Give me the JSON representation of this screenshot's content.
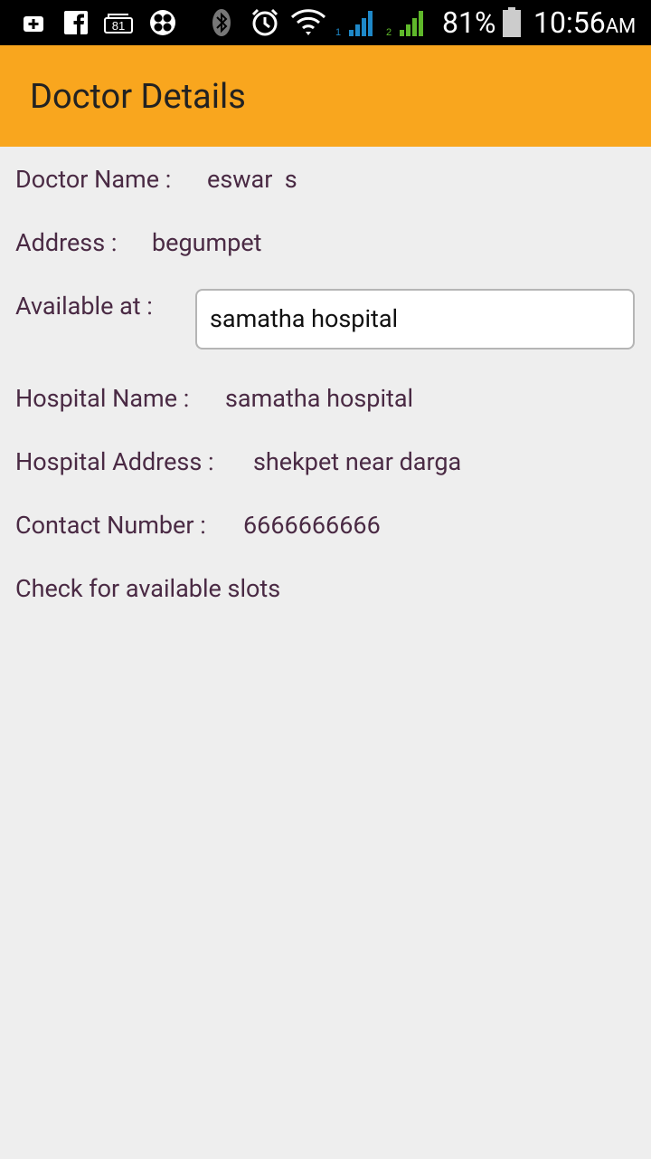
{
  "status_bar": {
    "battery_percent": "81%",
    "time": "10:56",
    "ampm": "AM",
    "sim1_label": "1",
    "sim2_label": "2",
    "notification_badge": "81",
    "icons": [
      "plus-box-icon",
      "facebook-icon",
      "notification-81-icon",
      "fan-icon",
      "bluetooth-icon",
      "alarm-icon",
      "wifi-icon",
      "signal-sim1-icon",
      "signal-sim2-icon",
      "battery-icon"
    ]
  },
  "action_bar": {
    "title": "Doctor Details"
  },
  "details": {
    "doctor_name_label": "Doctor Name :",
    "doctor_name_value": "eswar  s",
    "address_label": "Address :",
    "address_value": "begumpet",
    "available_at_label": "Available at :",
    "available_at_value": "samatha hospital",
    "hospital_name_label": "Hospital Name :",
    "hospital_name_value": "samatha hospital",
    "hospital_address_label": "Hospital Address :",
    "hospital_address_value": "shekpet near darga",
    "contact_number_label": "Contact Number :",
    "contact_number_value": "6666666666",
    "check_slots_label": "Check for available slots"
  },
  "colors": {
    "action_bar": "#f9a61e",
    "text": "#4a2a44",
    "background": "#eeeeee",
    "signal_sim1": "#1e88c8",
    "signal_sim2": "#5fb82a"
  }
}
